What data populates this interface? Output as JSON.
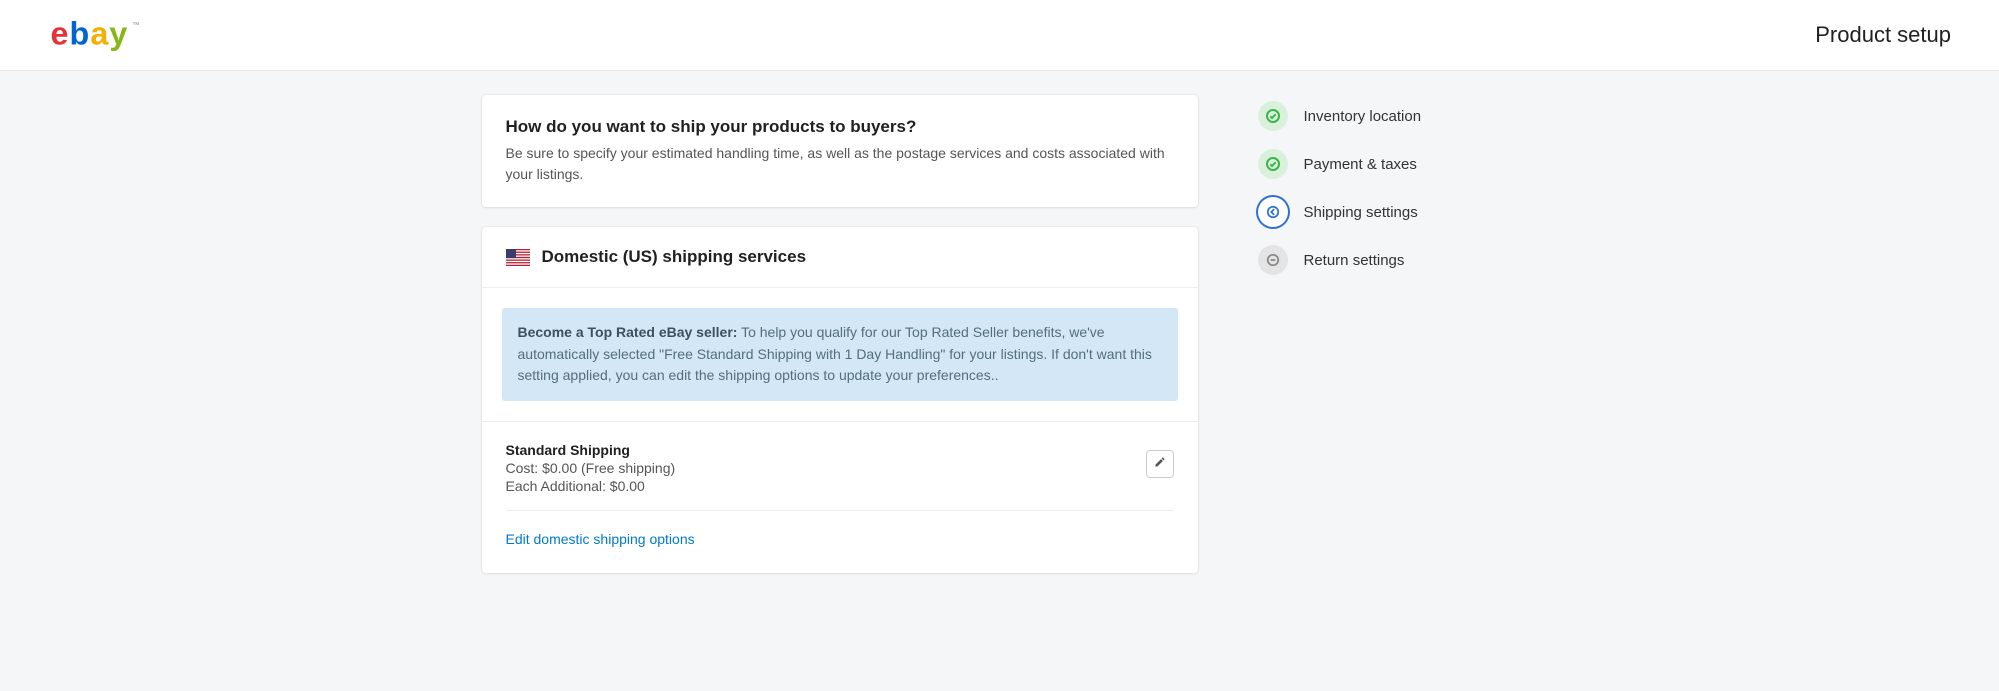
{
  "header": {
    "page_title": "Product setup"
  },
  "intro": {
    "title": "How do you want to ship your products to buyers?",
    "description": "Be sure to specify your estimated handling time, as well as the postage services and costs associated with your listings."
  },
  "section": {
    "title": "Domestic (US) shipping services"
  },
  "note": {
    "prefix": "Become a Top Rated eBay seller:",
    "body": " To help you qualify for our Top Rated Seller benefits, we've automatically selected \"Free Standard Shipping with 1 Day Handling\" for your listings. If don't want this setting applied, you can edit the shipping options to update your preferences.."
  },
  "shipping": {
    "name": "Standard Shipping",
    "cost_line": "Cost: $0.00 (Free shipping)",
    "additional_line": "Each Additional: $0.00",
    "edit_link": "Edit domestic shipping options"
  },
  "steps": {
    "inventory": "Inventory location",
    "payment": "Payment & taxes",
    "shipping": "Shipping settings",
    "returns": "Return settings"
  }
}
